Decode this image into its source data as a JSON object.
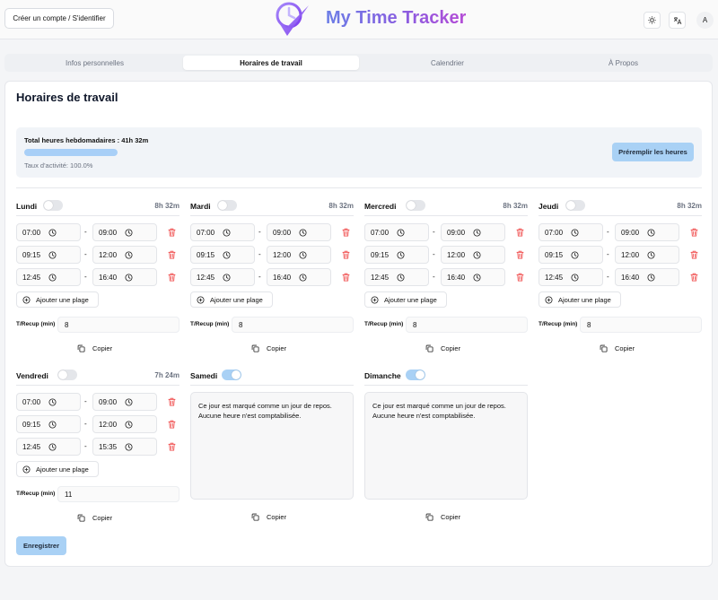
{
  "header": {
    "account_button": "Créer un compte / S'identifier",
    "brand": "My Time Tracker",
    "avatar_initial": "A"
  },
  "tabs": [
    {
      "label": "Infos personnelles",
      "active": false
    },
    {
      "label": "Horaires de travail",
      "active": true
    },
    {
      "label": "Calendrier",
      "active": false
    },
    {
      "label": "À Propos",
      "active": false
    }
  ],
  "page": {
    "title": "Horaires de travail",
    "summary_title": "Total heures hebdomadaires : 41h 32m",
    "activity_rate": "Taux d'activité: 100.0%",
    "activity_fraction": 1.0,
    "prefill_button": "Préremplir les heures",
    "save_button": "Enregistrer"
  },
  "labels": {
    "add_slot": "Ajouter une plage",
    "recup": "T/Recup (min)",
    "copy": "Copier",
    "dash": "-"
  },
  "days": [
    {
      "name": "Lundi",
      "enabled": false,
      "total": "8h 32m",
      "recup": "8",
      "slots": [
        [
          "07:00",
          "09:00"
        ],
        [
          "09:15",
          "12:00"
        ],
        [
          "12:45",
          "16:40"
        ]
      ]
    },
    {
      "name": "Mardi",
      "enabled": false,
      "total": "8h 32m",
      "recup": "8",
      "slots": [
        [
          "07:00",
          "09:00"
        ],
        [
          "09:15",
          "12:00"
        ],
        [
          "12:45",
          "16:40"
        ]
      ]
    },
    {
      "name": "Mercredi",
      "enabled": false,
      "total": "8h 32m",
      "recup": "8",
      "slots": [
        [
          "07:00",
          "09:00"
        ],
        [
          "09:15",
          "12:00"
        ],
        [
          "12:45",
          "16:40"
        ]
      ]
    },
    {
      "name": "Jeudi",
      "enabled": false,
      "total": "8h 32m",
      "recup": "8",
      "slots": [
        [
          "07:00",
          "09:00"
        ],
        [
          "09:15",
          "12:00"
        ],
        [
          "12:45",
          "16:40"
        ]
      ]
    },
    {
      "name": "Vendredi",
      "enabled": false,
      "total": "7h 24m",
      "recup": "11",
      "slots": [
        [
          "07:00",
          "09:00"
        ],
        [
          "09:15",
          "12:00"
        ],
        [
          "12:45",
          "15:35"
        ]
      ]
    },
    {
      "name": "Samedi",
      "enabled": true,
      "rest": true,
      "rest_text": "Ce jour est marqué comme un jour de repos. Aucune heure n'est comptabilisée."
    },
    {
      "name": "Dimanche",
      "enabled": true,
      "rest": true,
      "rest_text": "Ce jour est marqué comme un jour de repos. Aucune heure n'est comptabilisée."
    }
  ],
  "colors": {
    "accent": "#a9d1f5",
    "trash": "#ef4444",
    "brand_start": "#6b7de6",
    "brand_end": "#b44bd6"
  }
}
